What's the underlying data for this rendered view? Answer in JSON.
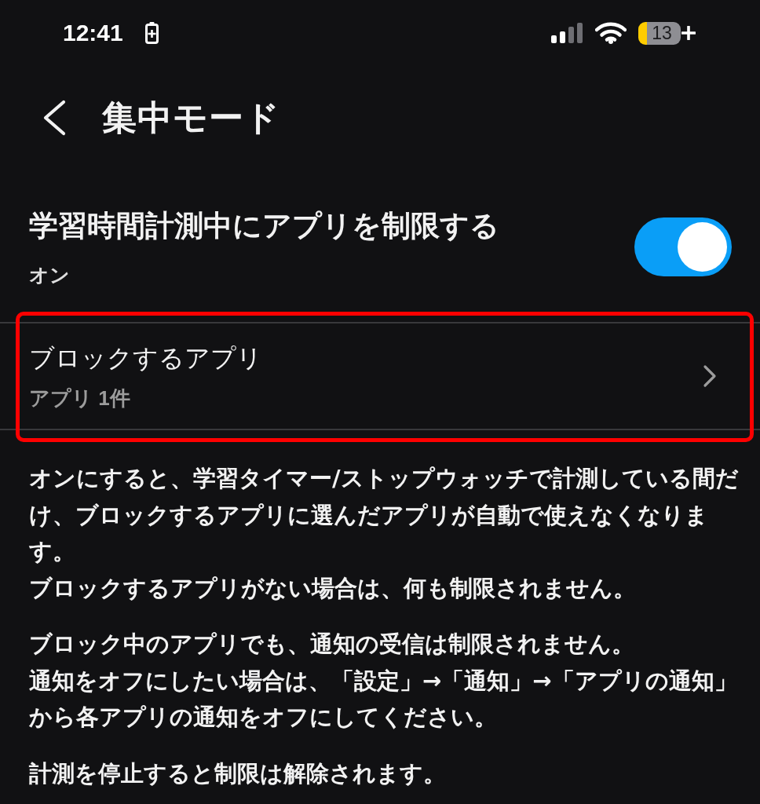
{
  "status_bar": {
    "time": "12:41",
    "battery_percent": "13"
  },
  "header": {
    "title": "集中モード"
  },
  "restrict_setting": {
    "title": "学習時間計測中にアプリを制限する",
    "value": "オン",
    "on": true
  },
  "block_apps_row": {
    "title": "ブロックするアプリ",
    "subtitle": "アプリ 1件",
    "highlighted": true
  },
  "description": [
    {
      "sentences": [
        "オンにすると、学習タイマー/ストップウォッチで計測している間だけ、ブロックするアプリに選んだアプリが自動で使えなくなります。",
        "ブロックするアプリがない場合は、何も制限されません。"
      ]
    },
    {
      "sentences": [
        "ブロック中のアプリでも、通知の受信は制限されません。",
        "通知をオフにしたい場合は、「設定」→「通知」→「アプリの通知」から各アプリの通知をオフにしてください。"
      ]
    },
    {
      "sentences": [
        "計測を停止すると制限は解除されます。"
      ]
    }
  ]
}
